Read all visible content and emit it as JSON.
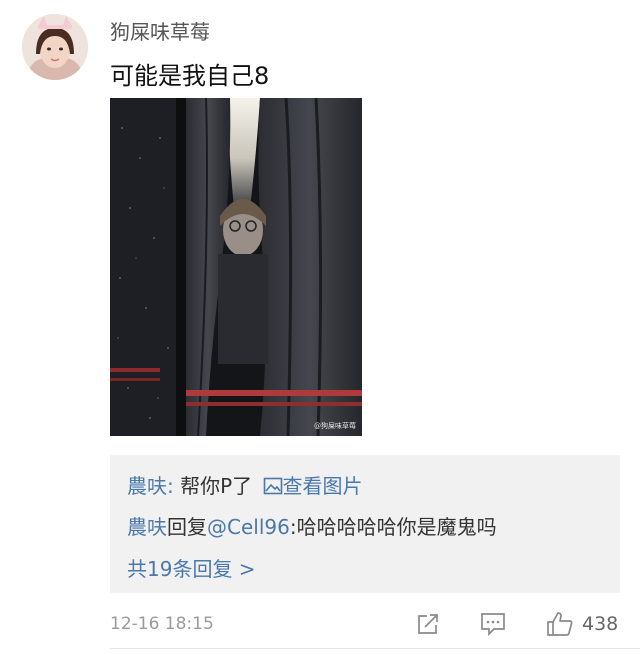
{
  "comment": {
    "username": "狗屎味草莓",
    "text": "可能是我自己8",
    "photo_watermark": "@狗屎味草莓",
    "timestamp": "12-16 18:15",
    "like_count": "438"
  },
  "replies": {
    "reply1": {
      "user": "農呋:",
      "text": "帮你P了",
      "link_label": "查看图片"
    },
    "reply2": {
      "user": "農呋",
      "action": "回复",
      "mention": "@Cell96",
      "text": ":哈哈哈哈哈你是魔鬼吗"
    },
    "more_label": "共19条回复 >"
  },
  "icons": {
    "avatar": "avatar",
    "image_link": "image-icon",
    "share": "share-icon",
    "comment": "comment-icon",
    "like": "thumbs-up-icon"
  },
  "colors": {
    "link": "#4a78ac",
    "reply_background": "#f1f1f1",
    "muted": "#9a9a9a"
  }
}
